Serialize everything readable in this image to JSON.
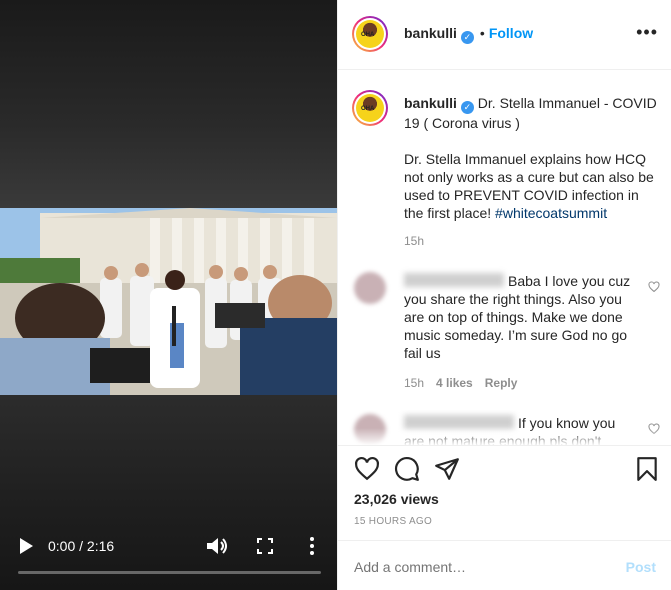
{
  "video": {
    "time": "0:00 / 2:16",
    "progress": 0
  },
  "header": {
    "username": "bankulli",
    "separator": "•",
    "follow_label": "Follow",
    "more_label": "•••"
  },
  "caption": {
    "username": "bankulli",
    "title": "Dr. Stella Immanuel - COVID 19 ( Corona virus )",
    "body": "Dr. Stella Immanuel explains how HCQ not only works as a cure but can also be used to PREVENT COVID infection in the first place!",
    "hashtag": "#whitecoatsummit",
    "time": "15h"
  },
  "comments": [
    {
      "text": "Baba I love you cuz you share the right things. Also you are on top of things. Make we done music someday. I’m sure God no go fail us",
      "time": "15h",
      "likes": "4 likes",
      "reply": "Reply"
    },
    {
      "text": "If you know you are not mature enough pls don't",
      "time": "",
      "likes": "",
      "reply": ""
    }
  ],
  "post_meta": {
    "views": "23,026 views",
    "posted": "15 HOURS AGO"
  },
  "add_comment": {
    "placeholder": "Add a comment…",
    "post_label": "Post"
  },
  "colors": {
    "accent": "#0095f6",
    "post_disabled": "#b2dffc",
    "verified": "#3897f0"
  }
}
